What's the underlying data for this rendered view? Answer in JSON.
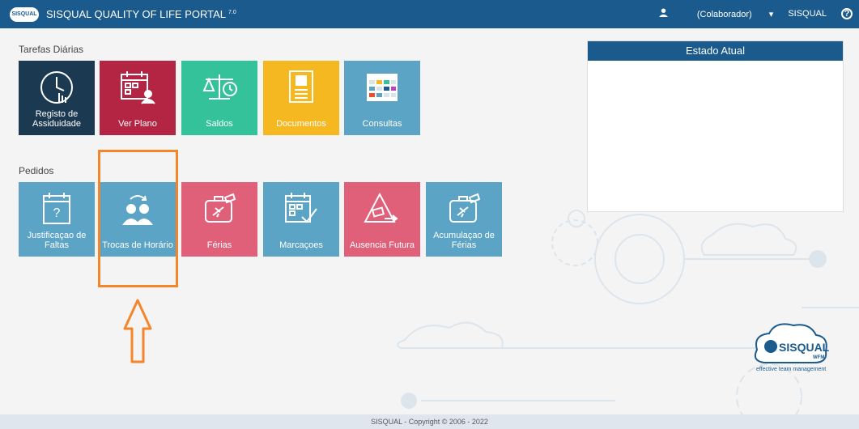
{
  "header": {
    "logo": "SISQUAL",
    "title": "SISQUAL QUALITY OF LIFE PORTAL",
    "version": "7.0",
    "user_menu": "(Colaborador)",
    "company": "SISQUAL"
  },
  "sections": {
    "daily": "Tarefas Diárias",
    "requests": "Pedidos"
  },
  "daily_tiles": [
    {
      "label": "Registo de Assiduidade",
      "color": "#1b3a52"
    },
    {
      "label": "Ver Plano",
      "color": "#b32542"
    },
    {
      "label": "Saldos",
      "color": "#33c29a"
    },
    {
      "label": "Documentos",
      "color": "#f6b820"
    },
    {
      "label": "Consultas",
      "color": "#5ba4c6"
    }
  ],
  "request_tiles": [
    {
      "label": "Justificaçao de Faltas",
      "color": "#5ba4c6"
    },
    {
      "label": "Trocas de Horário",
      "color": "#5ba4c6"
    },
    {
      "label": "Férias",
      "color": "#e0607a"
    },
    {
      "label": "Marcaçoes",
      "color": "#5ba4c6"
    },
    {
      "label": "Ausencia Futura",
      "color": "#e0607a"
    },
    {
      "label": "Acumulaçao de Férias",
      "color": "#5ba4c6"
    }
  ],
  "estado": {
    "title": "Estado Atual"
  },
  "brand": {
    "name": "SISQUAL",
    "tag": "WFM",
    "slogan": "effective team management"
  },
  "footer": {
    "text": "SISQUAL - Copyright © 2006 - 2022"
  }
}
